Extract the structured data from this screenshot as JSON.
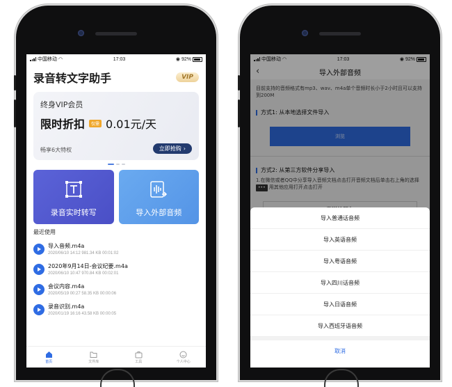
{
  "left_screen": {
    "status": {
      "carrier": "中国移动",
      "time": "17:03",
      "battery": "92%"
    },
    "app_title": "录音转文字助手",
    "vip_badge": "VIP",
    "vip_card": {
      "name": "终身VIP会员",
      "discount": "限时折扣",
      "tag": "仅需",
      "price": "0.01元/天",
      "privilege": "畅享6大特权",
      "buy_button": "立即抢购"
    },
    "tiles": {
      "record": "录音实时转写",
      "import": "导入外部音频"
    },
    "recent_title": "最近使用",
    "recordings": [
      {
        "name": "导入音频.m4a",
        "meta": "2020/06/10 14:12  981.34 KB  00:01:02"
      },
      {
        "name": "2020年9月14日-会议纪要.m4a",
        "meta": "2020/06/10 10:47  970.84 KB  00:02:01"
      },
      {
        "name": "会议内容.m4a",
        "meta": "2020/05/19 00:27  58.35 KB  00:00:06"
      },
      {
        "name": "录音识别.m4a",
        "meta": "2020/01/19 16:16  43.58 KB  00:00:05"
      }
    ],
    "tabbar": [
      "首页",
      "文件库",
      "工具",
      "个人中心"
    ]
  },
  "right_screen": {
    "status": {
      "carrier": "中国移动",
      "time": "17:03",
      "battery": "92%"
    },
    "nav_title": "导入外部音频",
    "support_text": "目前支持的音频格式有mp3、wav、m4a单个音频时长小于2小时且可以支持到200M",
    "method1_title": "方式1: 从本地选择文件导入",
    "browse_button": "浏览",
    "method2_title": "方式2: 从第三方软件分享导入",
    "method2_text_a": "1.在微信或者QQ中分享导入音频文档点击打开音频文档后单击右上角的选择",
    "method2_dots": "•••",
    "method2_text_b": "用其他应用打开点击打开",
    "send_friend": "发送给朋友",
    "sheet_options": [
      "导入普通话音频",
      "导入英语音频",
      "导入粤语音频",
      "导入四川话音频",
      "导入日语音频",
      "导入西班牙语音频"
    ],
    "cancel": "取消"
  },
  "colors": {
    "accent": "#2f6ce3",
    "tile_record": "#5258d0",
    "tile_import": "#5f9fec",
    "vip_button": "#223a6e",
    "vip_tag": "#f0a72b"
  }
}
